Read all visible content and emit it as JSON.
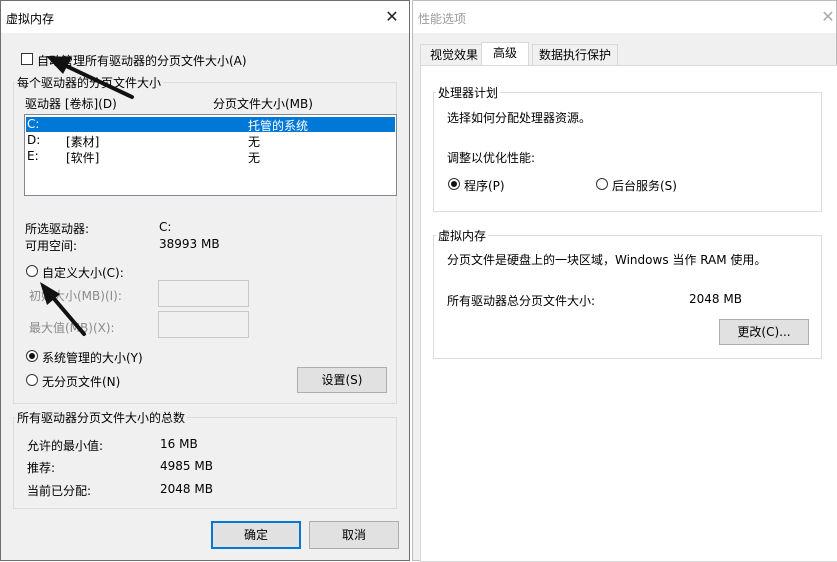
{
  "left_dialog": {
    "title": "虚拟内存",
    "close_glyph": "✕",
    "auto_manage_label": "自动管理所有驱动器的分页文件大小(A)",
    "per_drive_group": "每个驱动器的分页文件大小",
    "col_drive": "驱动器 [卷标](D)",
    "col_pagefile": "分页文件大小(MB)",
    "drives": [
      {
        "drive": "C:",
        "label": "",
        "size": "托管的系统"
      },
      {
        "drive": "D:",
        "label": "[素材]",
        "size": "无"
      },
      {
        "drive": "E:",
        "label": "[软件]",
        "size": "无"
      }
    ],
    "selected_drive_label": "所选驱动器:",
    "selected_drive_value": "C:",
    "free_space_label": "可用空间:",
    "free_space_value": "38993 MB",
    "custom_size_label": "自定义大小(C):",
    "initial_size_label": "初始大小(MB)(I):",
    "max_size_label": "最大值(MB)(X):",
    "system_managed_label": "系统管理的大小(Y)",
    "no_pagefile_label": "无分页文件(N)",
    "set_button": "设置(S)",
    "totals_group": "所有驱动器分页文件大小的总数",
    "min_allowed_label": "允许的最小值:",
    "min_allowed_value": "16 MB",
    "recommended_label": "推荐:",
    "recommended_value": "4985 MB",
    "current_label": "当前已分配:",
    "current_value": "2048 MB",
    "ok_button": "确定",
    "cancel_button": "取消"
  },
  "right_dialog": {
    "title": "性能选项",
    "close_glyph": "✕",
    "tabs": [
      "视觉效果",
      "高级",
      "数据执行保护"
    ],
    "processor_group": "处理器计划",
    "processor_desc": "选择如何分配处理器资源。",
    "optimize_label": "调整以优化性能:",
    "programs_label": "程序(P)",
    "background_label": "后台服务(S)",
    "vm_group": "虚拟内存",
    "vm_desc": "分页文件是硬盘上的一块区域，Windows 当作 RAM 使用。",
    "total_label": "所有驱动器总分页文件大小:",
    "total_value": "2048 MB",
    "change_button": "更改(C)..."
  },
  "colors": {
    "selection": "#0078d7",
    "dialog_bg": "#f0f0f0",
    "arrow": "#111111"
  }
}
